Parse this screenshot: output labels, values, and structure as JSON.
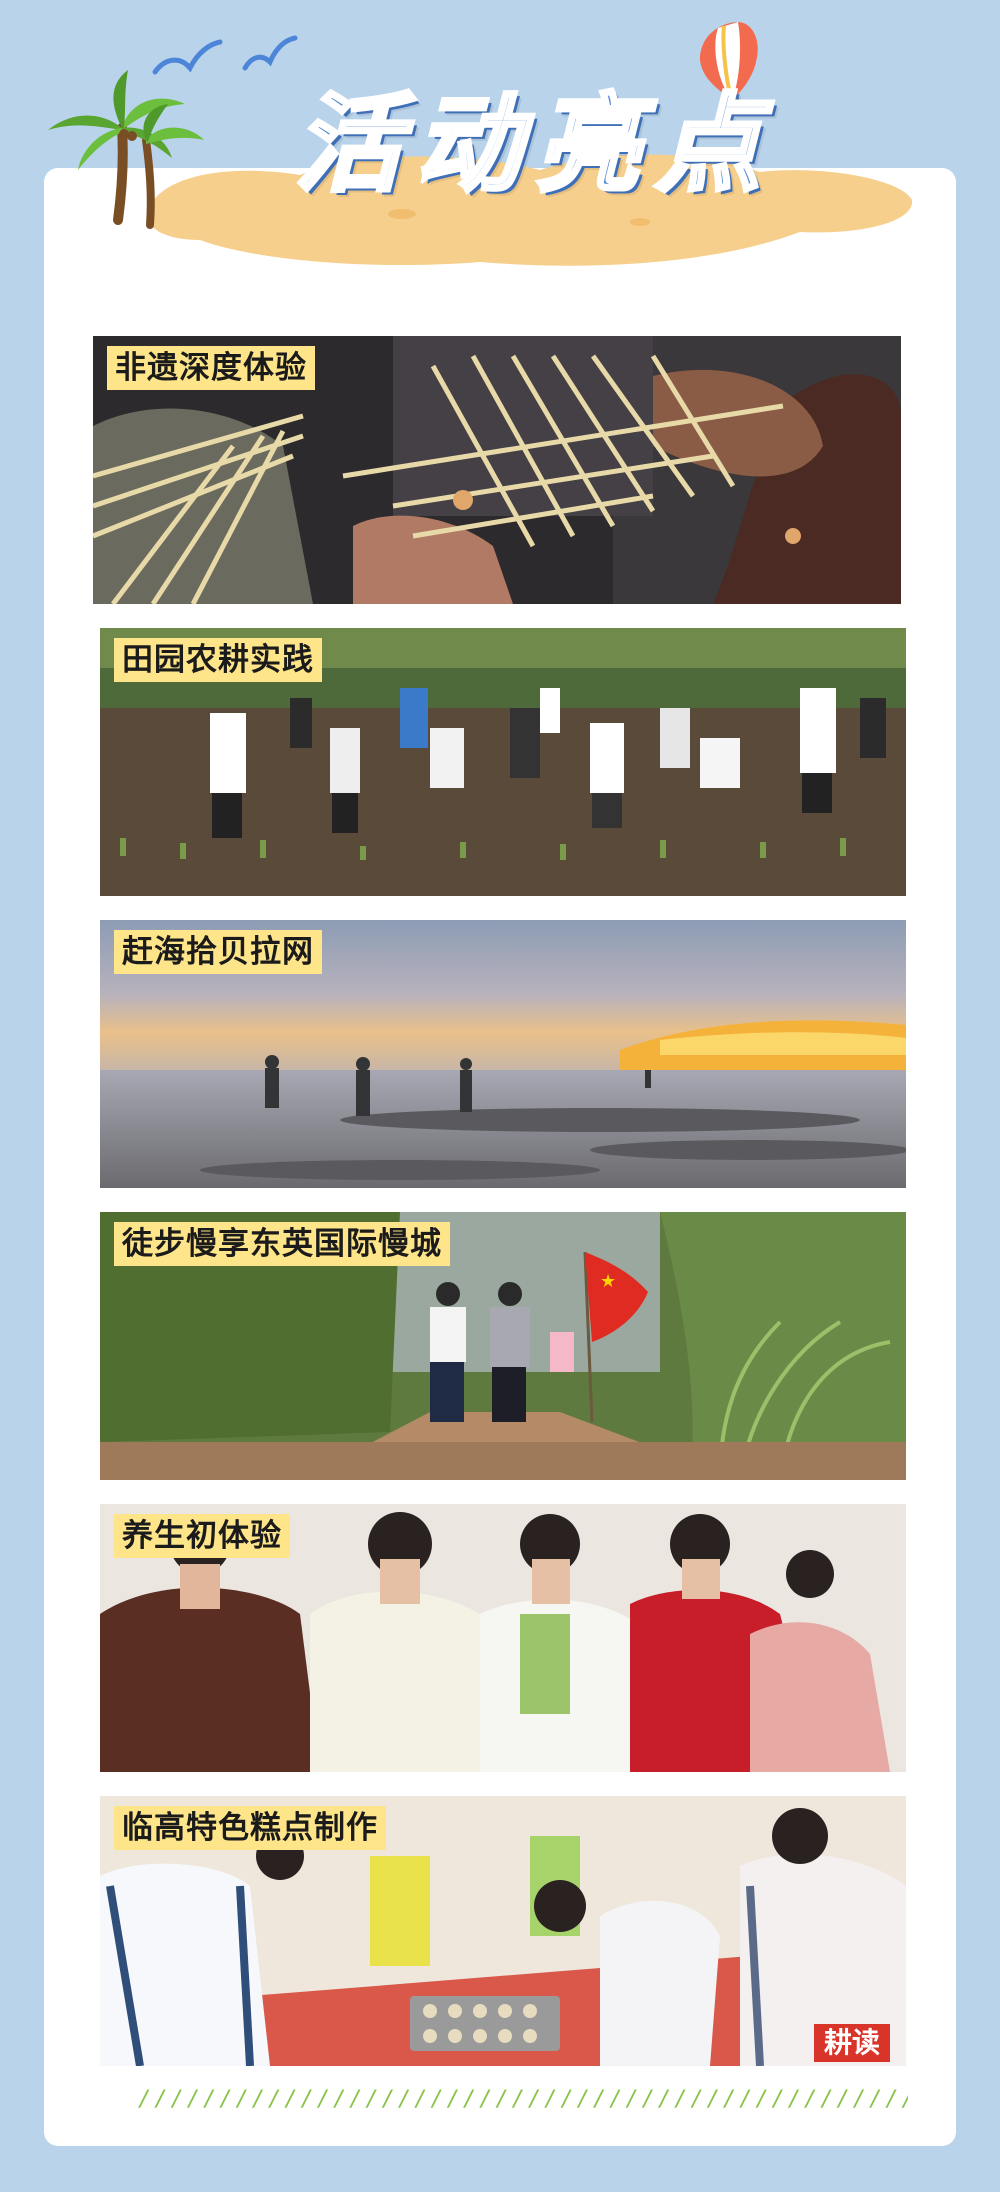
{
  "header": {
    "title": "活动亮点"
  },
  "activities": [
    {
      "label": "非遗深度体验"
    },
    {
      "label": "田园农耕实践"
    },
    {
      "label": "赶海拾贝拉网"
    },
    {
      "label": "徒步慢享东英国际慢城"
    },
    {
      "label": "养生初体验"
    },
    {
      "label": "临高特色糕点制作"
    }
  ],
  "watermark": "耕读",
  "divider": "///////////////////////////////////////////////////////",
  "colors": {
    "background": "#b9d3eb",
    "title": "#5b8fd6",
    "label_bg": "#ffe58a",
    "sand": "#f7cf8d",
    "divider": "#8bc34a"
  },
  "icons": [
    "palm-tree-icon",
    "bird-icon",
    "hot-air-balloon-icon"
  ]
}
